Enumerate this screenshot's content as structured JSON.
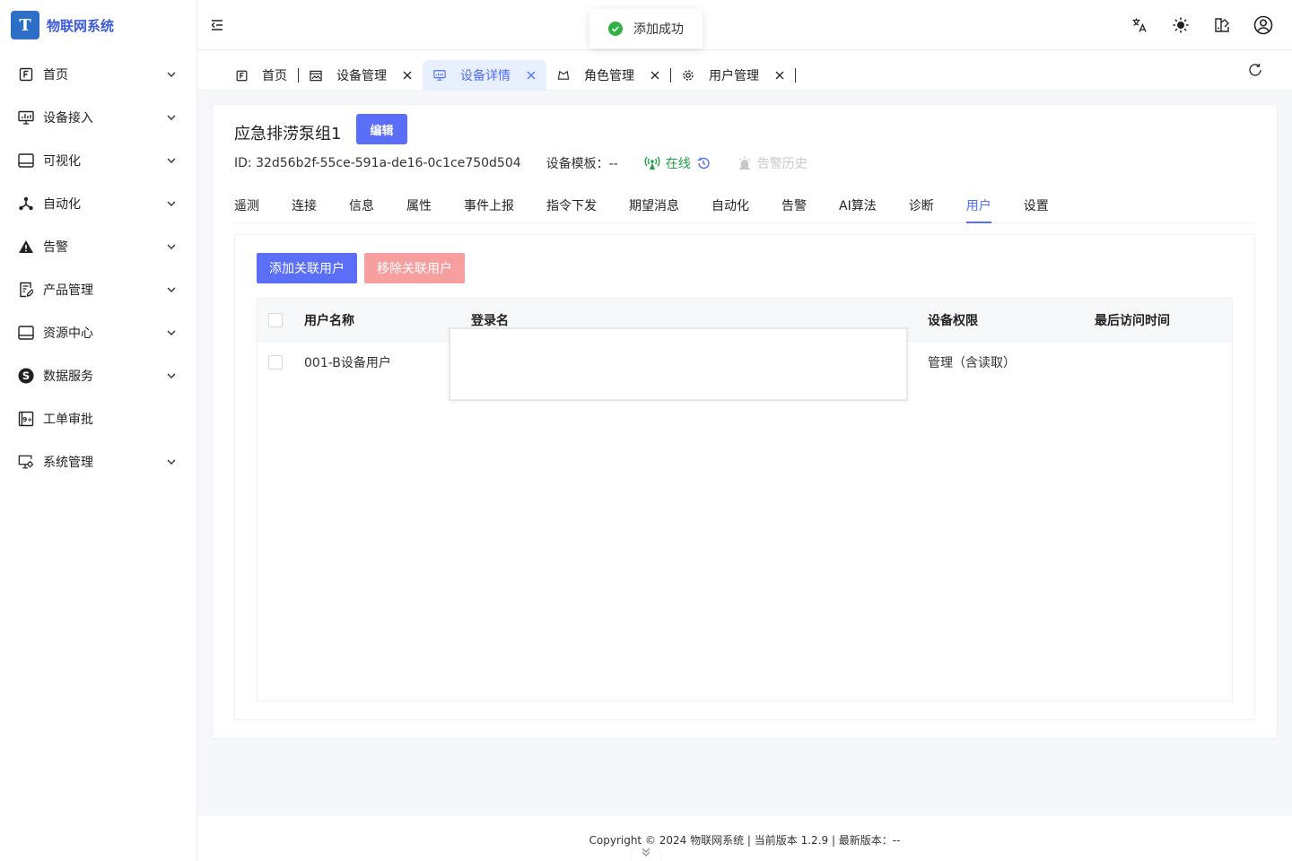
{
  "app": {
    "name": "物联网系统",
    "logo_letter": "T"
  },
  "sidebar": {
    "items": [
      {
        "label": "首页",
        "icon": "home-icon"
      },
      {
        "label": "设备接入",
        "icon": "monitor-icon"
      },
      {
        "label": "可视化",
        "icon": "screen-icon"
      },
      {
        "label": "自动化",
        "icon": "nodes-icon"
      },
      {
        "label": "告警",
        "icon": "warning-icon"
      },
      {
        "label": "产品管理",
        "icon": "edit-doc-icon"
      },
      {
        "label": "资源中心",
        "icon": "screen-icon"
      },
      {
        "label": "数据服务",
        "icon": "s-circle-icon"
      },
      {
        "label": "工单审批",
        "icon": "ticket-icon"
      },
      {
        "label": "系统管理",
        "icon": "settings-screen-icon"
      }
    ]
  },
  "tabs": [
    {
      "label": "首页",
      "closable": false
    },
    {
      "label": "设备管理",
      "closable": true
    },
    {
      "label": "设备详情",
      "closable": true,
      "active": true
    },
    {
      "label": "角色管理",
      "closable": true
    },
    {
      "label": "用户管理",
      "closable": true
    }
  ],
  "toast": {
    "message": "添加成功"
  },
  "device": {
    "name": "应急排涝泵组1",
    "edit_label": "编辑",
    "id_text": "ID:  32d56b2f-55ce-591a-de16-0c1ce750d504",
    "template_text": "设备模板：--",
    "status": "在线",
    "alarm_history": "告警历史"
  },
  "subtabs": [
    "遥测",
    "连接",
    "信息",
    "属性",
    "事件上报",
    "指令下发",
    "期望消息",
    "自动化",
    "告警",
    "AI算法",
    "诊断",
    "用户",
    "设置"
  ],
  "user_panel": {
    "add_label": "添加关联用户",
    "remove_label": "移除关联用户",
    "columns": [
      "用户名称",
      "登录名",
      "设备权限",
      "最后访问时间"
    ],
    "rows": [
      {
        "name": "001-B设备用户",
        "login": "",
        "permission": "管理（含读取）",
        "last_visit": ""
      }
    ]
  },
  "footer": {
    "text": "Copyright © 2024 物联网系统  |  当前版本 1.2.9  |  最新版本：--"
  },
  "colors": {
    "primary": "#5b6ef7",
    "danger_light": "#f79f9f",
    "success": "#22a045"
  }
}
